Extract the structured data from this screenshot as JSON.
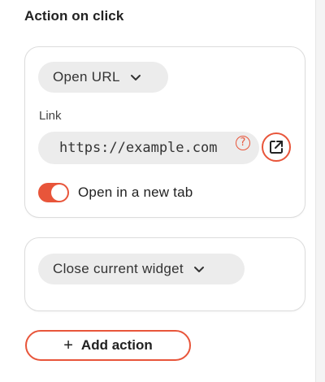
{
  "section": {
    "title": "Action on click"
  },
  "action_1": {
    "type_label": "Open URL",
    "link_label": "Link",
    "link_value": "https://example.com",
    "help_glyph": "?",
    "open_link_icon": "external-link-icon",
    "new_tab_label": "Open in a new tab",
    "new_tab_enabled": true
  },
  "action_2": {
    "type_label": "Close current widget"
  },
  "add_action": {
    "plus": "+",
    "label": "Add action"
  },
  "colors": {
    "accent": "#e8553a",
    "pill_bg": "#ececec",
    "border": "#dcdcdc"
  }
}
